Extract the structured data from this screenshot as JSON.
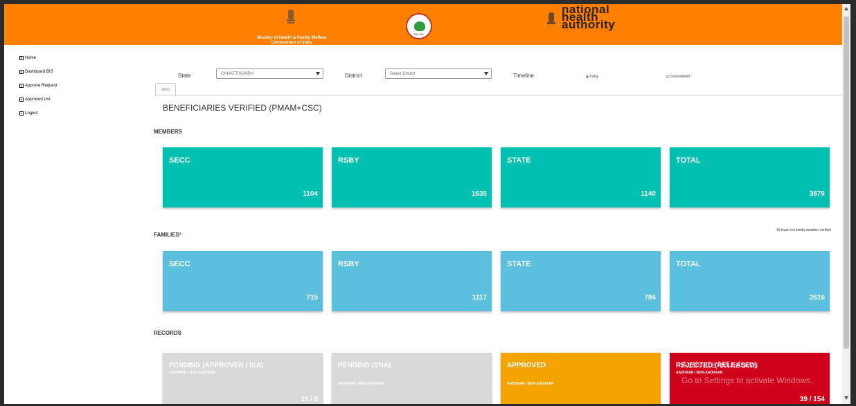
{
  "header": {
    "ministry_line1": "Ministry of Health & Family Welfare",
    "ministry_line2": "Government of India",
    "nha_line1": "national",
    "nha_line2": "health",
    "nha_line3": "authority",
    "pmjay_label": "PM-JAY"
  },
  "sidebar": {
    "items": [
      {
        "label": "Home"
      },
      {
        "label": "Dashboard BIS"
      },
      {
        "label": "Approve Request"
      },
      {
        "label": "Approved List"
      },
      {
        "label": "Logout"
      }
    ]
  },
  "filters": {
    "state_label": "State",
    "state_value": "CHHATTISGARH",
    "district_label": "District",
    "district_placeholder": "Select District",
    "timeline_label": "Timeline",
    "radio_today": "Today",
    "radio_consolidated": "Consolidated",
    "selected_timeline": "Today"
  },
  "tab": {
    "label": "Web"
  },
  "title": "BENEFICIARIES VERIFIED (PMAM+CSC)",
  "members": {
    "heading": "MEMBERS",
    "cards": [
      {
        "name": "SECC",
        "value": "1104"
      },
      {
        "name": "RSBY",
        "value": "1635"
      },
      {
        "name": "STATE",
        "value": "1140"
      },
      {
        "name": "TOTAL",
        "value": "3879"
      }
    ]
  },
  "families": {
    "heading": "FAMILIES",
    "star": "*",
    "note": "At least one family member verified",
    "cards": [
      {
        "name": "SECC",
        "value": "715"
      },
      {
        "name": "RSBY",
        "value": "1117"
      },
      {
        "name": "STATE",
        "value": "784"
      },
      {
        "name": "TOTAL",
        "value": "2616"
      }
    ]
  },
  "records": {
    "heading": "RECORDS",
    "cards": [
      {
        "name": "PENDING (APPROVER / ISA)",
        "sub": "AADHAAR / NON-AADHAAR",
        "value": "11 / 0"
      },
      {
        "name": "PENDING (SHA)",
        "sub": "AADHAAR / NON-AADHAAR",
        "value": ""
      },
      {
        "name": "APPROVED",
        "sub": "AADHAAR / NON-AADHAAR",
        "value": ""
      },
      {
        "name": "REJECTED (RELEASED)",
        "sub": "AADHAAR / NON-AADHAAR",
        "value": "39 / 154"
      }
    ]
  },
  "watermark": {
    "line1": "Activate Windows",
    "line2": "Go to Settings to activate Windows."
  },
  "colors": {
    "header": "#ff7f00",
    "members": "#00c0b2",
    "families": "#5bc0de",
    "pending": "#d9d9d9",
    "approved": "#f5a300",
    "rejected": "#d0021b"
  }
}
